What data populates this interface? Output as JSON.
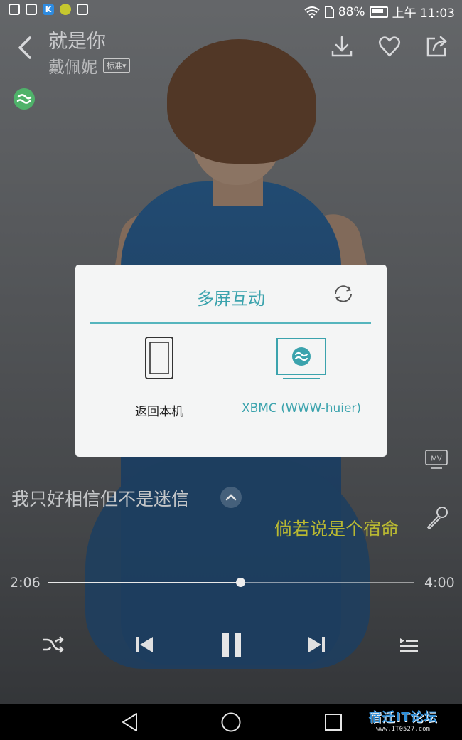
{
  "status_bar": {
    "battery_percent": "88%",
    "time": "上午 11:03",
    "left_icons": [
      "lock-icon",
      "image-icon",
      "k-app-icon",
      "app-round-icon",
      "multiscreen-icon"
    ]
  },
  "header": {
    "song_title": "就是你",
    "artist": "戴佩妮",
    "quality": "标准",
    "icons": [
      "back-icon",
      "download-icon",
      "heart-icon",
      "share-icon",
      "cast-active-icon"
    ]
  },
  "dialog": {
    "title": "多屏互动",
    "devices": [
      {
        "label": "返回本机",
        "icon": "phone-icon",
        "selected": false
      },
      {
        "label": "XBMC (WWW-huier)",
        "icon": "tv-cast-icon",
        "selected": true
      }
    ]
  },
  "mv_label": "MV",
  "lyrics": {
    "current": "我只好相信但不是迷信",
    "next": "倘若说是个宿命"
  },
  "playback": {
    "elapsed": "2:06",
    "total": "4:00",
    "progress": 0.525
  },
  "colors": {
    "accent": "#3ba3ad",
    "lyric_highlight": "#b8b832"
  },
  "watermark": {
    "main": "宿迁IT论坛",
    "sub": "www.IT0527.com"
  }
}
